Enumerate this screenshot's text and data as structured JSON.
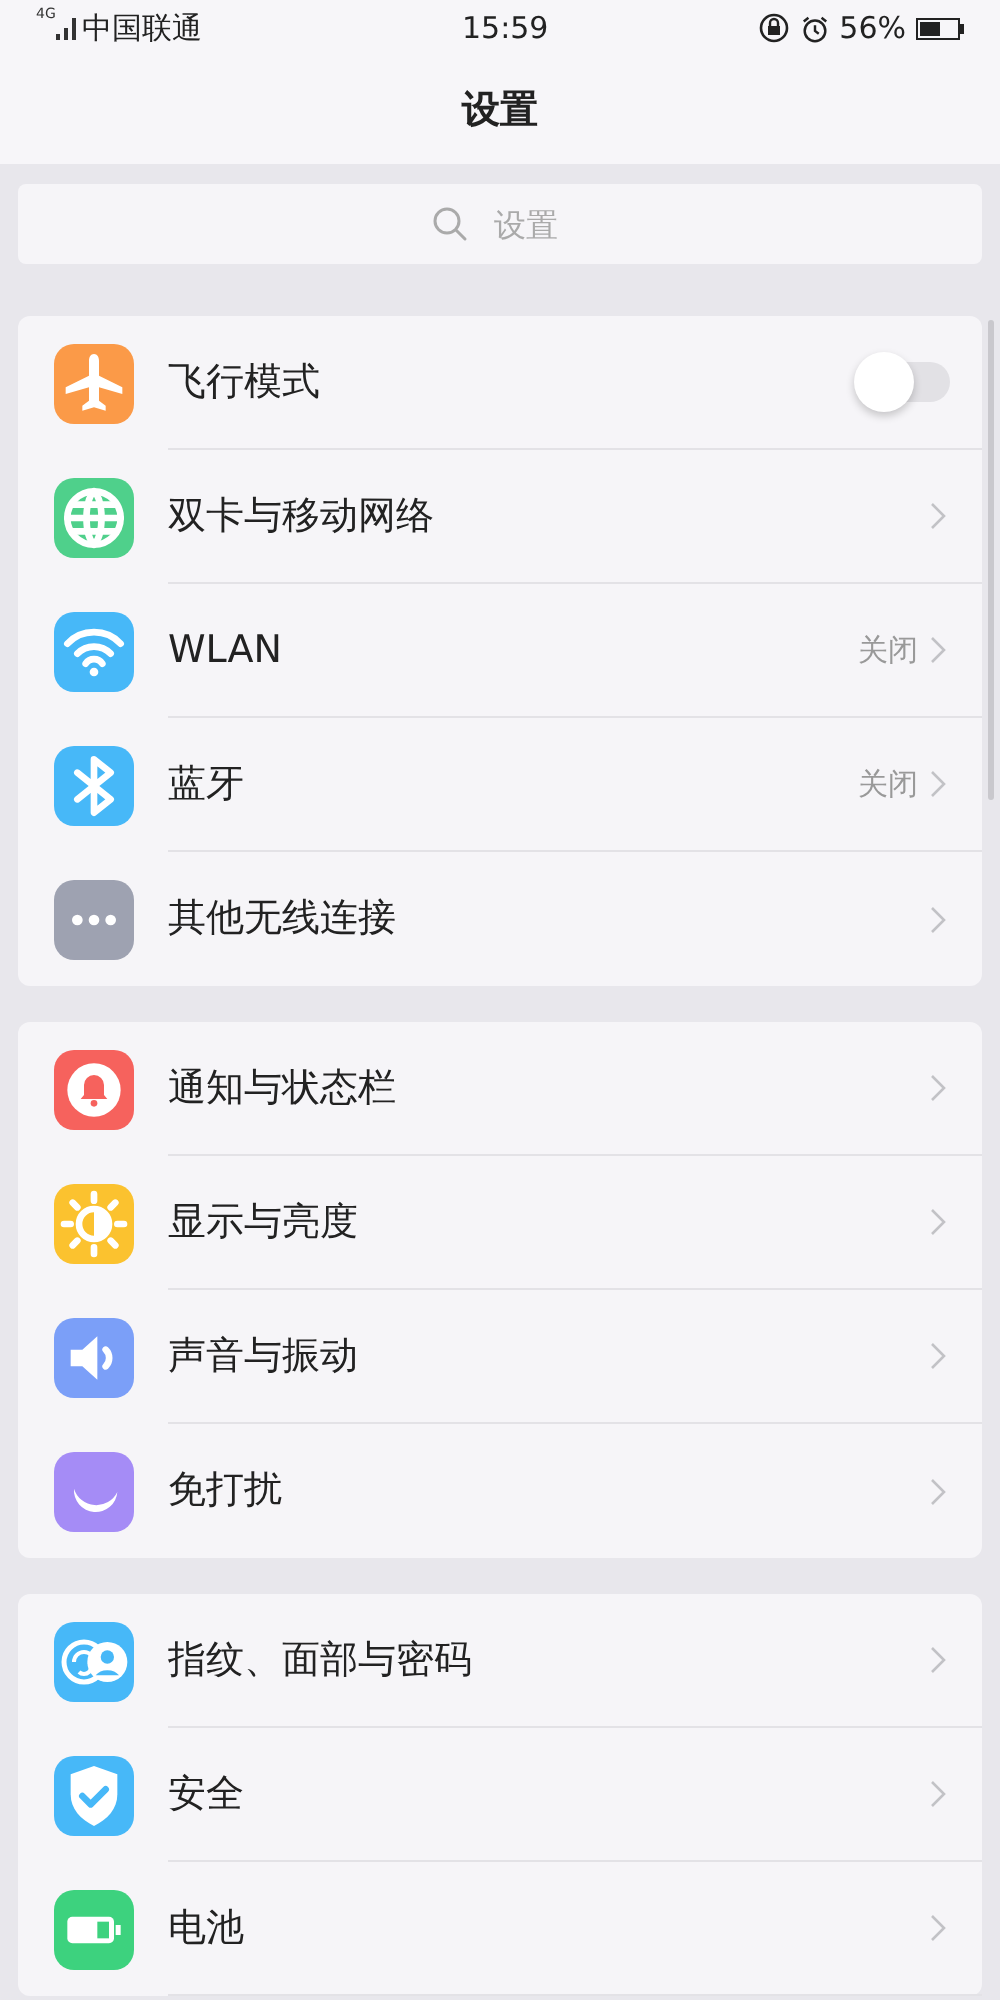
{
  "status_bar": {
    "network": "4G",
    "carrier": "中国联通",
    "time": "15:59",
    "battery": "56%"
  },
  "header": {
    "title": "设置"
  },
  "search": {
    "placeholder": "设置"
  },
  "groups": [
    {
      "items": [
        {
          "kind": "toggle",
          "label": "飞行模式",
          "on": false,
          "color": "#fb9a48"
        },
        {
          "kind": "link",
          "label": "双卡与移动网络",
          "color": "#4fd08b"
        },
        {
          "kind": "link",
          "label": "WLAN",
          "value": "关闭",
          "color": "#47b8f8"
        },
        {
          "kind": "link",
          "label": "蓝牙",
          "value": "关闭",
          "color": "#47b8f8"
        },
        {
          "kind": "link",
          "label": "其他无线连接",
          "color": "#9ea2b1"
        }
      ]
    },
    {
      "items": [
        {
          "kind": "link",
          "label": "通知与状态栏",
          "color": "#f6625d"
        },
        {
          "kind": "link",
          "label": "显示与亮度",
          "color": "#fbc22f"
        },
        {
          "kind": "link",
          "label": "声音与振动",
          "color": "#7b9ff8"
        },
        {
          "kind": "link",
          "label": "免打扰",
          "color": "#a58cf6"
        }
      ]
    },
    {
      "items": [
        {
          "kind": "link",
          "label": "指纹、面部与密码",
          "color": "#47b8f8"
        },
        {
          "kind": "link",
          "label": "安全",
          "color": "#47b8f8"
        },
        {
          "kind": "link",
          "label": "电池",
          "color": "#3dd27e"
        }
      ]
    }
  ]
}
